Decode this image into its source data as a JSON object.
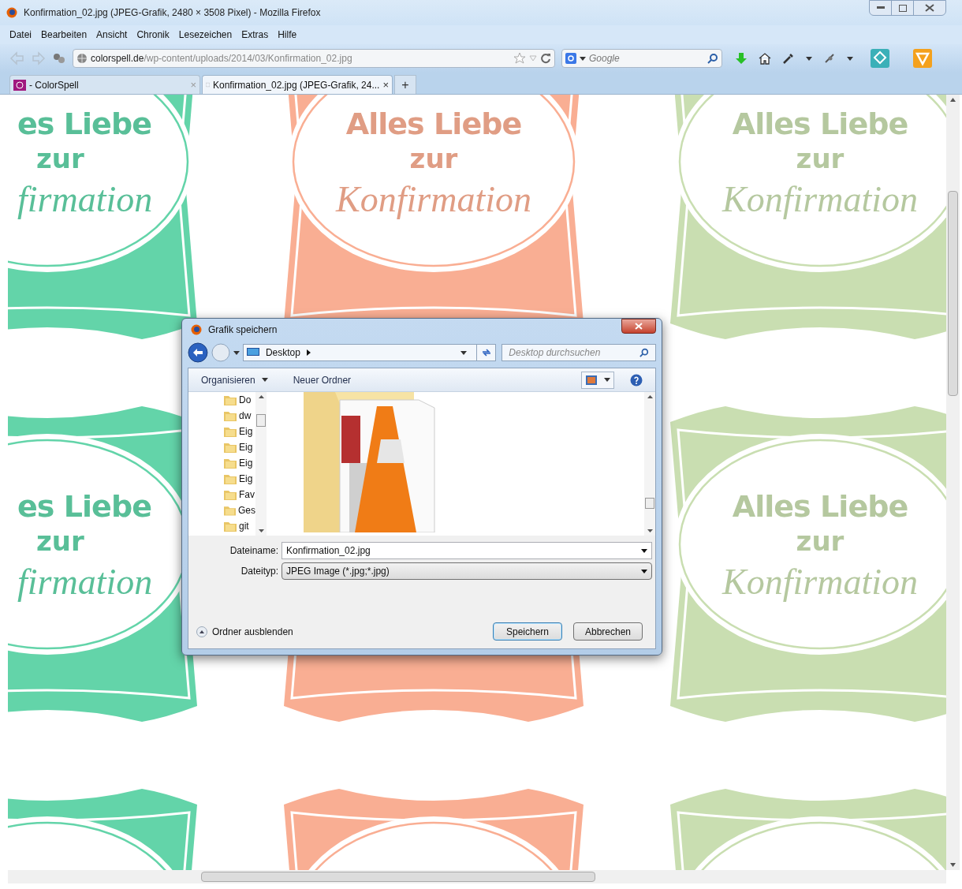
{
  "window": {
    "title": "Konfirmation_02.jpg (JPEG-Grafik, 2480 × 3508 Pixel) - Mozilla Firefox"
  },
  "menu": [
    "Datei",
    "Bearbeiten",
    "Ansicht",
    "Chronik",
    "Lesezeichen",
    "Extras",
    "Hilfe"
  ],
  "navigation": {
    "url": "**colorspell.de**/wp-content/uploads/2014/03/Konfirmation_02.jpg",
    "search_placeholder": "Google"
  },
  "tabs": [
    {
      "label": "- ColorSpell",
      "close": "×",
      "selected": false
    },
    {
      "label": "Konfirmation_02.jpg (JPEG-Grafik, 24...",
      "close": "×",
      "selected": true
    }
  ],
  "new_tab": "+",
  "image_tiles": [
    {
      "color": "#63d4a9",
      "lines": [
        "es Liebe",
        "zur",
        "firmation"
      ]
    },
    {
      "color": "#f9ae93",
      "lines": [
        "Alles Liebe",
        "zur",
        "Konfirmation"
      ]
    },
    {
      "color": "#c9deb1",
      "lines": [
        "Alles Liebe",
        "zur",
        "Konfirmation"
      ]
    },
    {
      "color": "#63d4a9",
      "lines": [
        "es Liebe",
        "zur",
        "firmation"
      ]
    },
    {
      "color": "#f9ae93"
    },
    {
      "color": "#c9deb1",
      "lines": [
        "Alles Liebe",
        "zur",
        "Konfirmation"
      ]
    },
    {
      "color": "#63d4a9"
    },
    {
      "color": "#f9ae93"
    },
    {
      "color": "#c9deb1"
    }
  ],
  "dialog": {
    "title": "Grafik speichern",
    "location": "Desktop",
    "search_placeholder": "Desktop durchsuchen",
    "toolbar": [
      "Organisieren",
      "Neuer Ordner"
    ],
    "folders": [
      "Do",
      "dw",
      "Eig",
      "Eig",
      "Eig",
      "Eig",
      "Fav",
      "Ges",
      "git"
    ],
    "fields": [
      {
        "label": "Dateiname:",
        "value": "Konfirmation_02.jpg"
      },
      {
        "label": "Dateityp:",
        "value": "JPEG Image (*.jpg;*.jpg)"
      }
    ],
    "hide_folders": "Ordner ausblenden",
    "buttons": [
      {
        "label": "Speichern",
        "kind": "primary"
      },
      {
        "label": "Abbrechen",
        "kind": "normal"
      }
    ]
  }
}
